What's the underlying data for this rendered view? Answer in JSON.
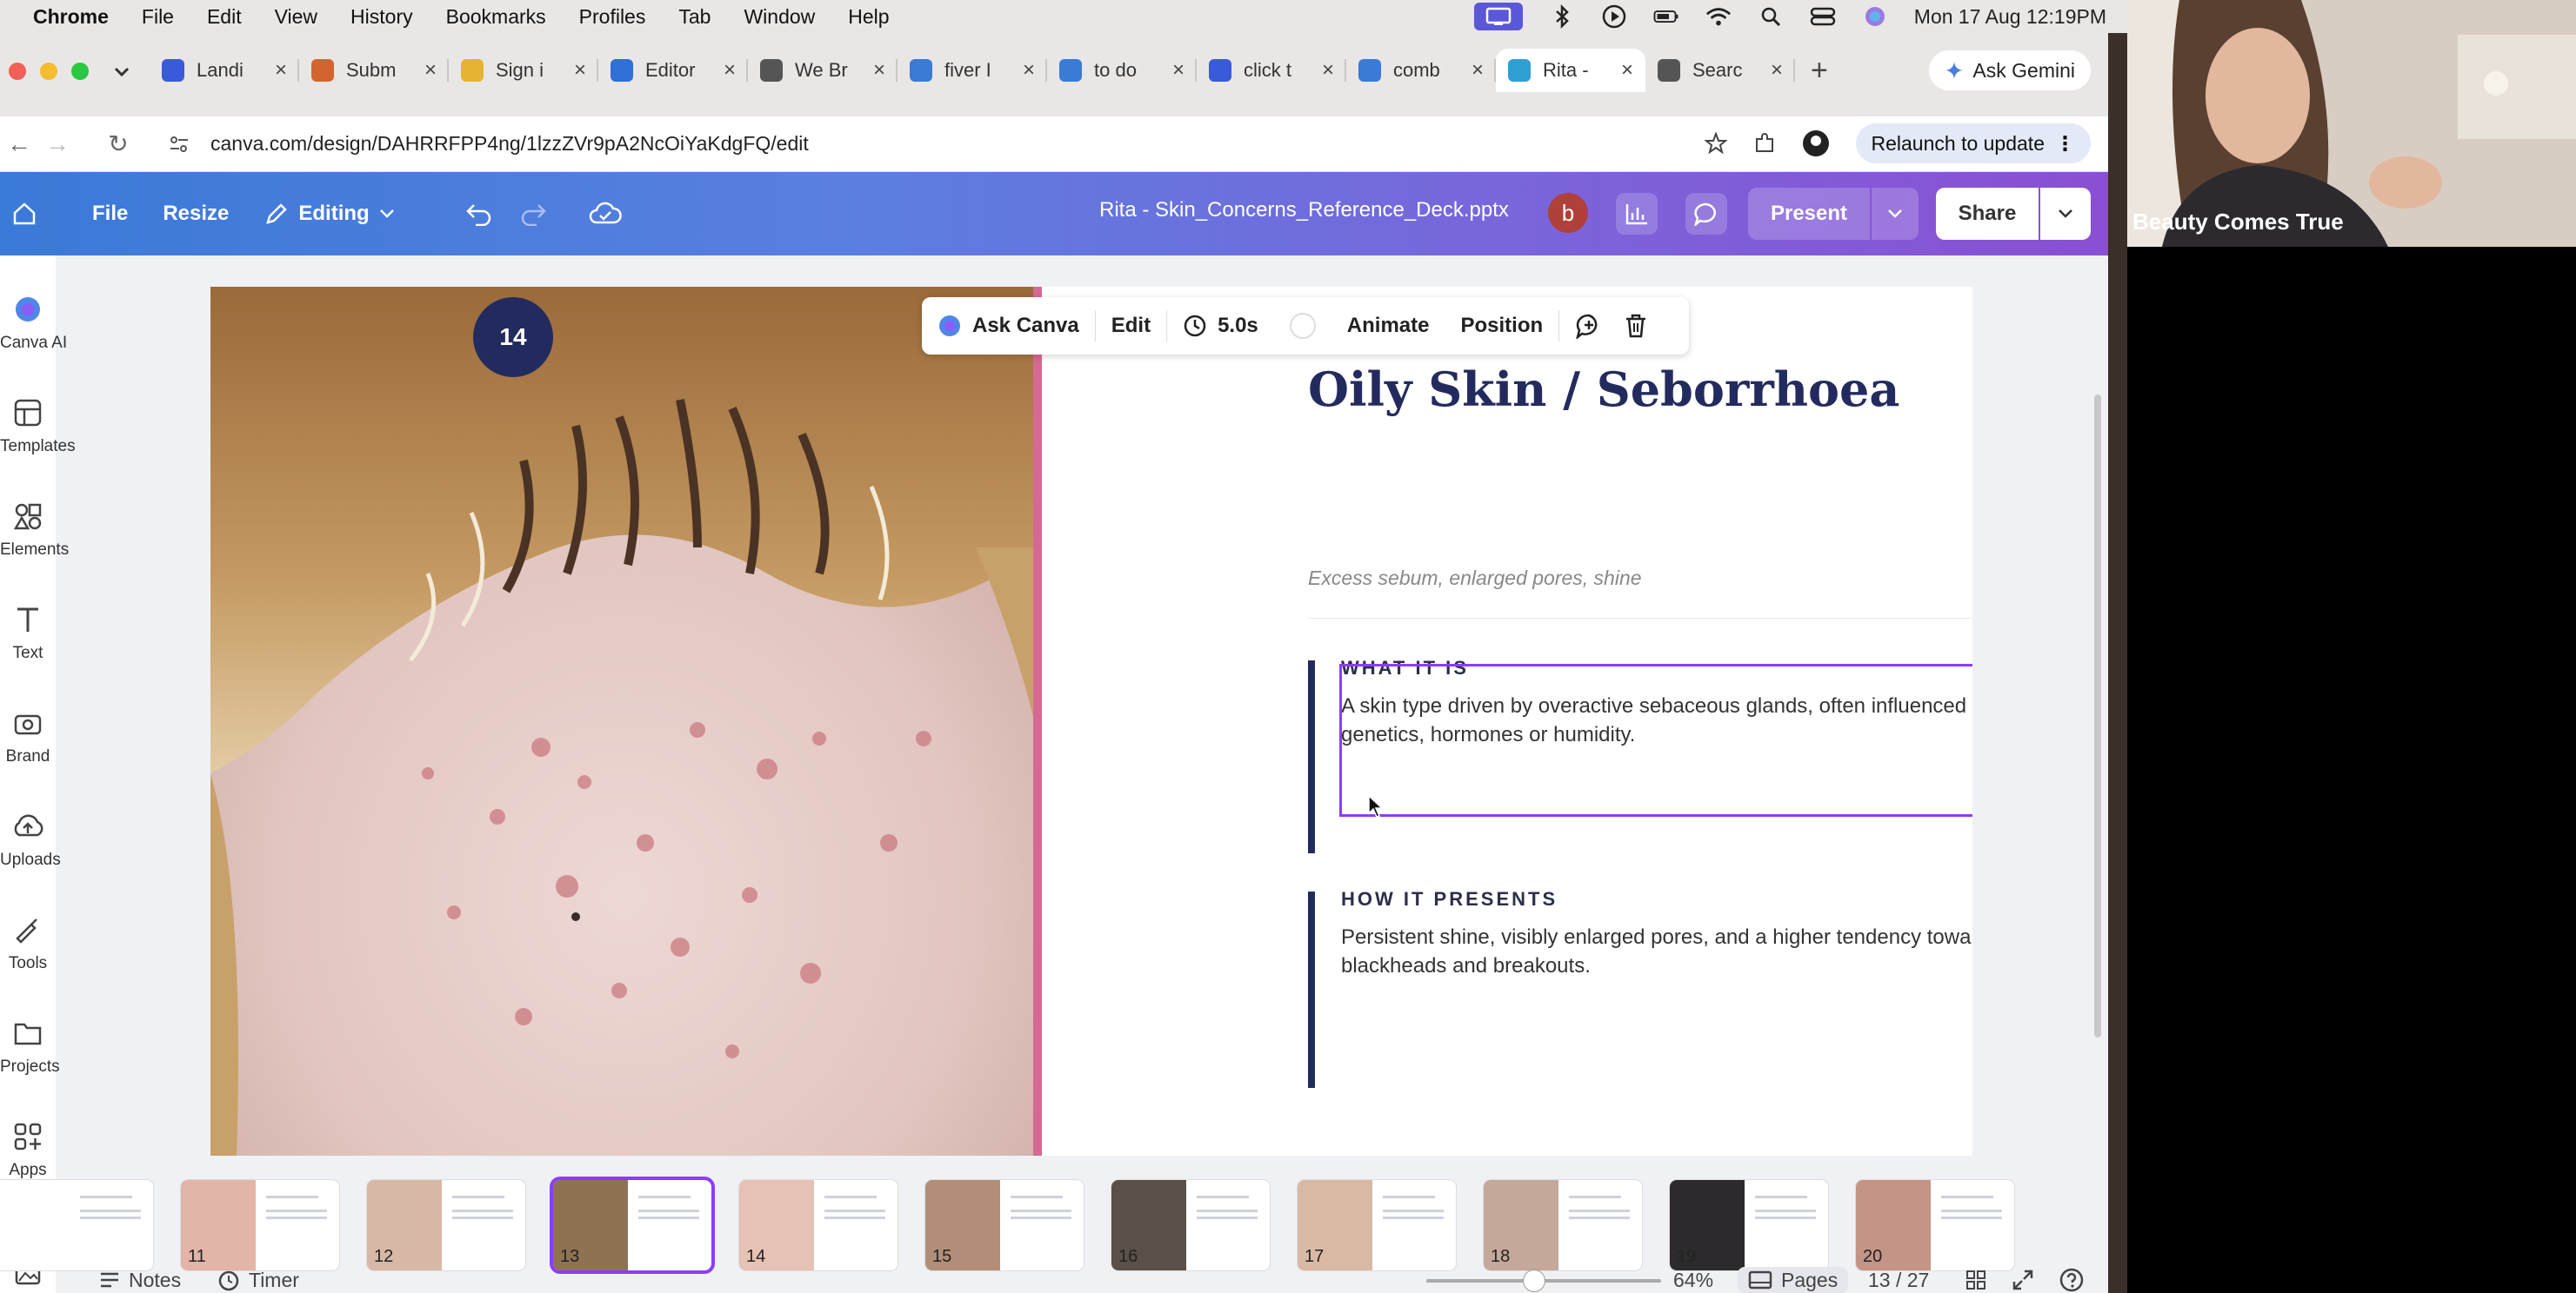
{
  "menubar": {
    "app": "Chrome",
    "items": [
      "File",
      "Edit",
      "View",
      "History",
      "Bookmarks",
      "Profiles",
      "Tab",
      "Window",
      "Help"
    ],
    "clock": "Mon 17 Aug  12:19PM"
  },
  "tabs": [
    {
      "title": "Landi",
      "color": "#3a5bd9"
    },
    {
      "title": "Subm",
      "color": "#d2652f"
    },
    {
      "title": "Sign i",
      "color": "#e6b430"
    },
    {
      "title": "Editor",
      "color": "#2f6fd6"
    },
    {
      "title": "We Br",
      "color": "#555555"
    },
    {
      "title": "fiver I",
      "color": "#3a7bd5"
    },
    {
      "title": "to do",
      "color": "#3a7bd5"
    },
    {
      "title": "click t",
      "color": "#3a5bd9"
    },
    {
      "title": "comb",
      "color": "#3a7bd5"
    },
    {
      "title": "Rita -",
      "color": "#2f9fd6",
      "active": true
    },
    {
      "title": "Searc",
      "color": "#555555"
    }
  ],
  "browser": {
    "gemini_label": "Ask Gemini",
    "url": "canva.com/design/DAHRRFPP4ng/1lzzZVr9pA2NcOiYaKdgFQ/edit",
    "relaunch_label": "Relaunch to update"
  },
  "canva_toolbar": {
    "file": "File",
    "resize": "Resize",
    "editing": "Editing",
    "doc_title": "Rita - Skin_Concerns_Reference_Deck.pptx",
    "avatar_letter": "b",
    "present": "Present",
    "share": "Share"
  },
  "sidebar": [
    {
      "label": "Canva AI",
      "icon": "canva-ai-icon"
    },
    {
      "label": "Templates",
      "icon": "templates-icon"
    },
    {
      "label": "Elements",
      "icon": "elements-icon"
    },
    {
      "label": "Text",
      "icon": "text-icon"
    },
    {
      "label": "Brand",
      "icon": "brand-icon"
    },
    {
      "label": "Uploads",
      "icon": "uploads-icon"
    },
    {
      "label": "Tools",
      "icon": "tools-icon"
    },
    {
      "label": "Projects",
      "icon": "projects-icon"
    },
    {
      "label": "Apps",
      "icon": "apps-icon"
    }
  ],
  "context_toolbar": {
    "ask_canva": "Ask Canva",
    "edit": "Edit",
    "duration": "5.0s",
    "animate": "Animate",
    "position": "Position"
  },
  "slide": {
    "page_badge": "14",
    "title": "Oily Skin / Seborrhoea",
    "subtitle": "Excess sebum, enlarged pores, shine",
    "sections": [
      {
        "heading": "WHAT IT IS",
        "text": "A skin type driven by overactive sebaceous glands, often influenced by genetics, hormones or humidity."
      },
      {
        "heading": "HOW IT PRESENTS",
        "text": "Persistent shine, visibly enlarged pores, and a higher tendency toward blackheads and breakouts."
      }
    ]
  },
  "thumbnails": [
    {
      "num": "",
      "color": "#ffffff"
    },
    {
      "num": "11",
      "color": "#e3b4a8"
    },
    {
      "num": "12",
      "color": "#d7b8a6"
    },
    {
      "num": "13",
      "color": "#8f7252",
      "selected": true
    },
    {
      "num": "14",
      "color": "#e6c2b4"
    },
    {
      "num": "15",
      "color": "#b28e78"
    },
    {
      "num": "16",
      "color": "#5a5047"
    },
    {
      "num": "17",
      "color": "#d9b9a4"
    },
    {
      "num": "18",
      "color": "#c4a89a"
    },
    {
      "num": "19",
      "color": "#2c2a2c"
    },
    {
      "num": "20",
      "color": "#c49487"
    }
  ],
  "bottombar": {
    "notes": "Notes",
    "timer": "Timer",
    "zoom": "64%",
    "pages": "Pages",
    "page_count": "13 / 27"
  },
  "video": {
    "participant_name": "Beauty Comes True"
  },
  "colors": {
    "brand_navy": "#232b5e",
    "accent_pink": "#d46a93",
    "selection_purple": "#8b3dff"
  }
}
